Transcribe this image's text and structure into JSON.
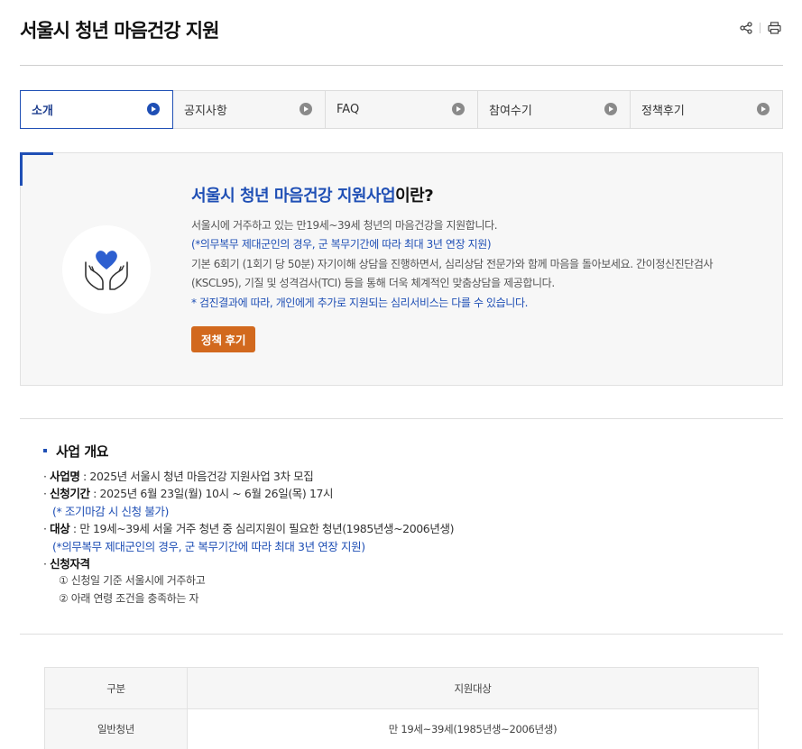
{
  "header": {
    "title": "서울시 청년 마음건강 지원"
  },
  "tabs": [
    {
      "label": "소개",
      "active": true
    },
    {
      "label": "공지사항",
      "active": false
    },
    {
      "label": "FAQ",
      "active": false
    },
    {
      "label": "참여수기",
      "active": false
    },
    {
      "label": "정책후기",
      "active": false
    }
  ],
  "intro": {
    "heading_highlight": "서울시 청년 마음건강 지원사업",
    "heading_suffix": "이란?",
    "line1": "서울시에 거주하고 있는 만19세~39세 청년의 마음건강을 지원합니다.",
    "line2": "(*의무복무 제대군인의 경우, 군 복무기간에 따라 최대 3년 연장 지원)",
    "line3": "기본 6회기 (1회기 당 50분) 자기이해 상담을 진행하면서, 심리상담 전문가와 함께 마음을 돌아보세요. 간이정신진단검사",
    "line4": "(KSCL95), 기질 및 성격검사(TCI) 등을 통해 더욱 체계적인 맞춤상담을 제공합니다.",
    "line5": "* 검진결과에 따라, 개인에게 추가로 지원되는 심리서비스는 다를 수 있습니다.",
    "button_label": "정책 후기"
  },
  "overview": {
    "title": "사업 개요",
    "item1_label": "사업명",
    "item1_value": " : 2025년 서울시 청년 마음건강 지원사업 3차 모집",
    "item2_label": "신청기간",
    "item2_value": " : 2025년 6월 23일(월) 10시 ~ 6월 26일(목) 17시",
    "item2_note": "(* 조기마감 시 신청 불가)",
    "item3_label": "대상",
    "item3_value": " : 만 19세~39세 서울 거주 청년 중 심리지원이 필요한 청년(1985년생~2006년생)",
    "item3_note": "(*의무복무 제대군인의 경우, 군 복무기간에 따라 최대 3년 연장 지원)",
    "item4_label": "신청자격",
    "sub1": "① 신청일 기준 서울시에 거주하고",
    "sub2": "② 아래 연령 조건을 충족하는 자"
  },
  "table": {
    "headers": [
      "구분",
      "지원대상"
    ],
    "rows": [
      [
        "일반청년",
        "만 19세~39세(1985년생~2006년생)"
      ]
    ]
  },
  "colors": {
    "accent": "#1f4fb5",
    "button": "#d2691e"
  }
}
